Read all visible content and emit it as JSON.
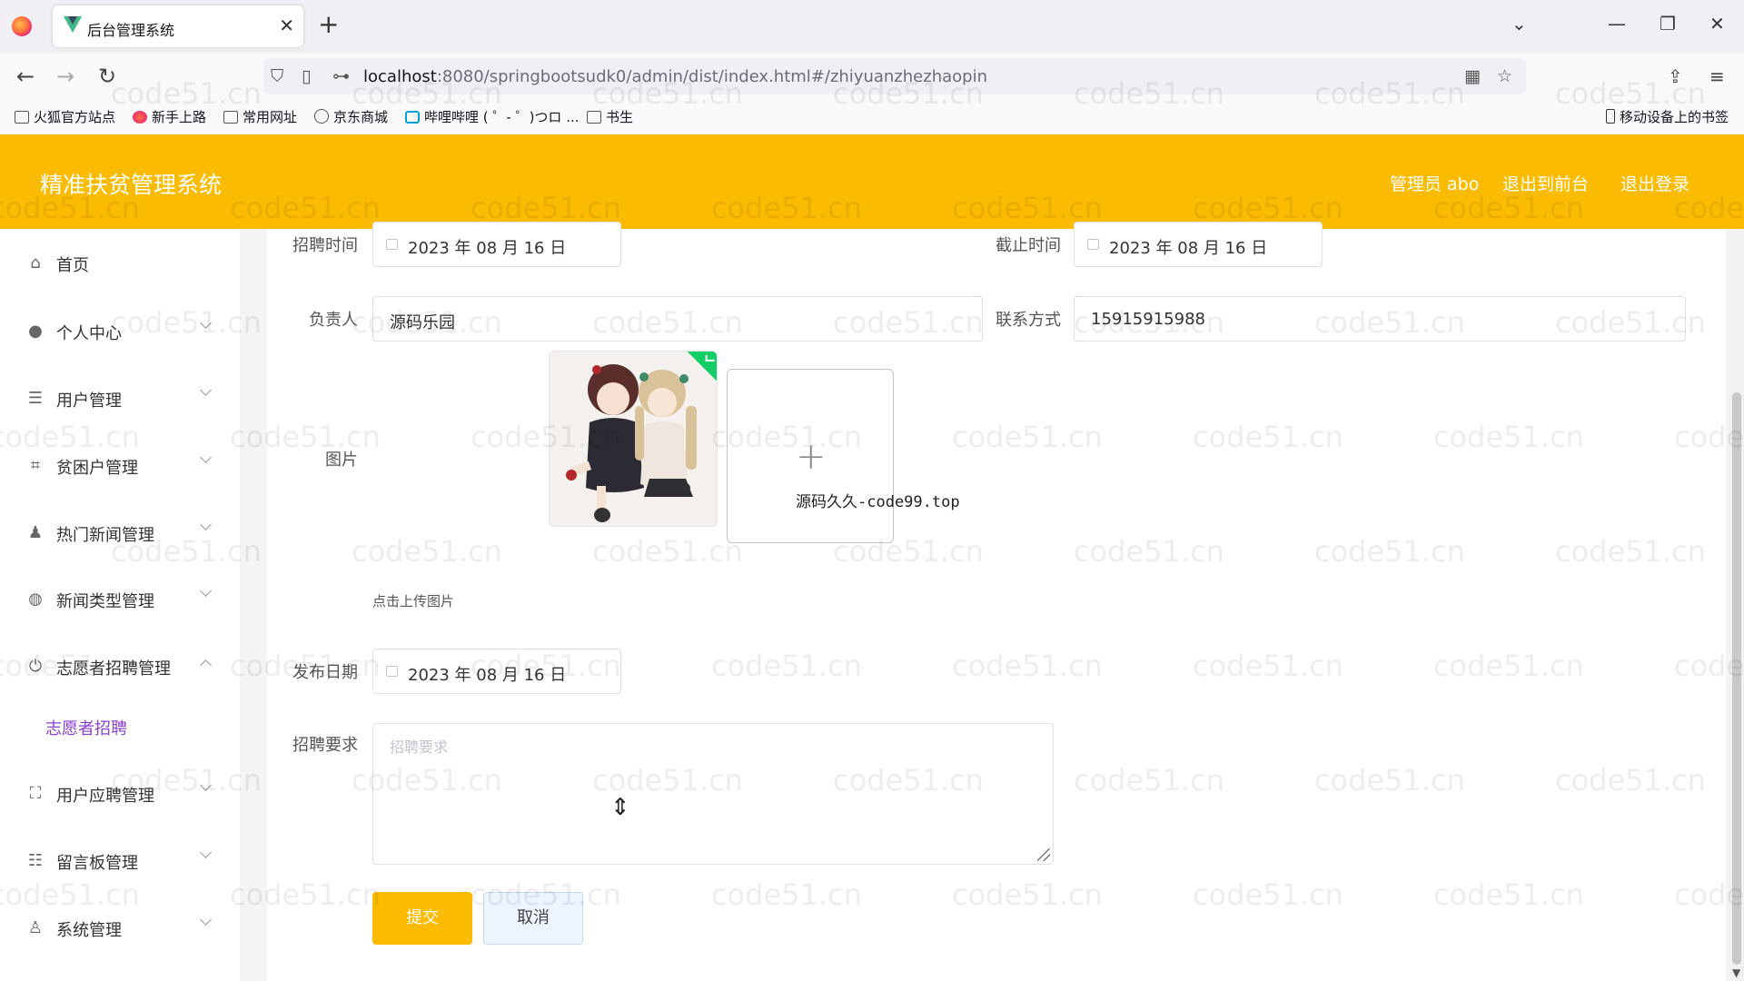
{
  "browser": {
    "tab_title": "后台管理系统",
    "tab_close": "✕",
    "new_tab": "+",
    "url_host": "localhost",
    "url_path": ":8080/springbootsudk0/admin/dist/index.html#/zhiyuanzhezhaopin",
    "window_controls": {
      "minimize": "—",
      "restore": "❐",
      "close": "✕",
      "tabs_list": "⌄"
    },
    "nav_icons": {
      "back": "←",
      "forward": "→",
      "reload": "↻"
    },
    "bookmarks": [
      "火狐官方站点",
      "新手上路",
      "常用网址",
      "京东商城",
      "哔哩哔哩 ( ゜- ゜)つロ ...",
      "书生"
    ],
    "mobile_bookmarks": "移动设备上的书签"
  },
  "header": {
    "title": "精准扶贫管理系统",
    "admin_label": "管理员 abo",
    "exit_front": "退出到前台",
    "logout": "退出登录",
    "accent_color": "#fbbb00"
  },
  "sidebar": {
    "items": [
      {
        "label": "首页",
        "icon": "home-icon"
      },
      {
        "label": "个人中心",
        "icon": "user-icon"
      },
      {
        "label": "用户管理",
        "icon": "list-icon"
      },
      {
        "label": "贫困户管理",
        "icon": "crop-icon"
      },
      {
        "label": "热门新闻管理",
        "icon": "person-icon"
      },
      {
        "label": "新闻类型管理",
        "icon": "globe-icon"
      },
      {
        "label": "志愿者招聘管理",
        "icon": "power-icon"
      },
      {
        "label": "用户应聘管理",
        "icon": "fullscreen-icon"
      },
      {
        "label": "留言板管理",
        "icon": "sliders-icon"
      },
      {
        "label": "系统管理",
        "icon": "admin-icon"
      }
    ],
    "active_sub": "志愿者招聘"
  },
  "form": {
    "recruit_time_label": "招聘时间",
    "recruit_time_value": "2023 年 08 月 16 日",
    "deadline_label": "截止时间",
    "deadline_value": "2023 年 08 月 16 日",
    "owner_label": "负责人",
    "owner_value": "源码乐园",
    "contact_label": "联系方式",
    "contact_value": "15915915988",
    "image_label": "图片",
    "upload_overlay_text": "源码久久-code99.top",
    "upload_tip": "点击上传图片",
    "publish_date_label": "发布日期",
    "publish_date_value": "2023 年 08 月 16 日",
    "requirement_label": "招聘要求",
    "requirement_placeholder": "招聘要求",
    "submit": "提交",
    "cancel": "取消"
  },
  "watermark": "code51.cn"
}
